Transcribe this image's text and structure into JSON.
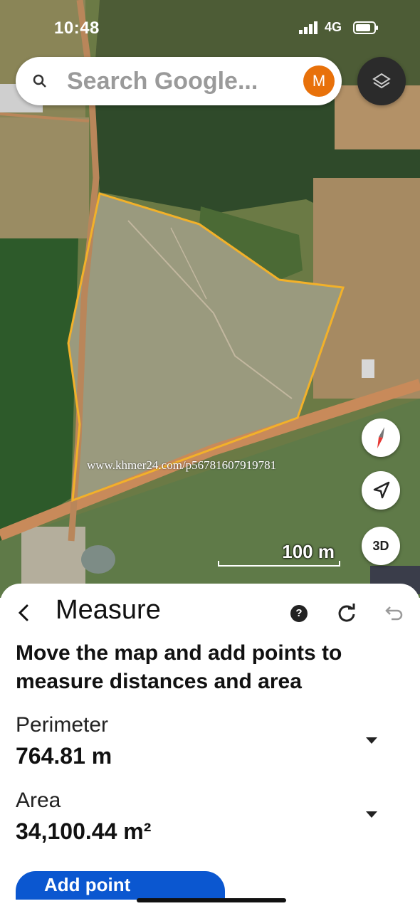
{
  "status_bar": {
    "time": "10:48",
    "network": "4G"
  },
  "search": {
    "placeholder": "Search Google...",
    "avatar_initial": "M"
  },
  "map": {
    "scale_label": "100 m",
    "three_d_label": "3D",
    "watermark": "www.khmer24.com/p56781607919781",
    "boundary_color": "#f2b12a"
  },
  "measure": {
    "title": "Measure",
    "help_label": "?",
    "instruction": "Move the map and add points to measure distances and area",
    "perimeter": {
      "label": "Perimeter",
      "value": "764.81 m"
    },
    "area": {
      "label": "Area",
      "value": "34,100.44 m²"
    },
    "primary_button": "Add point"
  },
  "colors": {
    "accent": "#0b57d0",
    "avatar": "#e8710a"
  }
}
